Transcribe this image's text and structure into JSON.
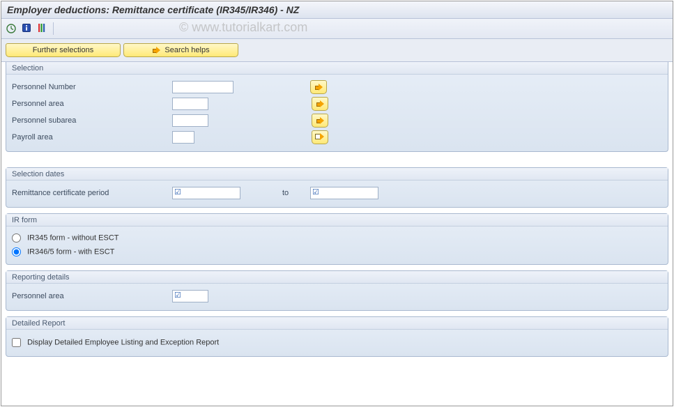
{
  "title": "Employer deductions: Remittance certificate (IR345/IR346) - NZ",
  "watermark": "© www.tutorialkart.com",
  "toolbar": {
    "further_selections": "Further selections",
    "search_helps": "Search helps"
  },
  "groups": {
    "selection": {
      "title": "Selection",
      "personnel_number_label": "Personnel Number",
      "personnel_number_value": "",
      "personnel_area_label": "Personnel area",
      "personnel_area_value": "",
      "personnel_subarea_label": "Personnel subarea",
      "personnel_subarea_value": "",
      "payroll_area_label": "Payroll area",
      "payroll_area_value": ""
    },
    "selection_dates": {
      "title": "Selection dates",
      "remittance_period_label": "Remittance certificate period",
      "from_value": "",
      "to_label": "to",
      "to_value": ""
    },
    "ir_form": {
      "title": "IR form",
      "option1_label": "IR345 form - without ESCT",
      "option2_label": "IR346/5 form - with ESCT",
      "selected": "option2"
    },
    "reporting": {
      "title": "Reporting details",
      "personnel_area_label": "Personnel area",
      "personnel_area_value": ""
    },
    "detailed": {
      "title": "Detailed Report",
      "checkbox_label": "Display Detailed Employee Listing and Exception Report",
      "checked": false
    }
  }
}
